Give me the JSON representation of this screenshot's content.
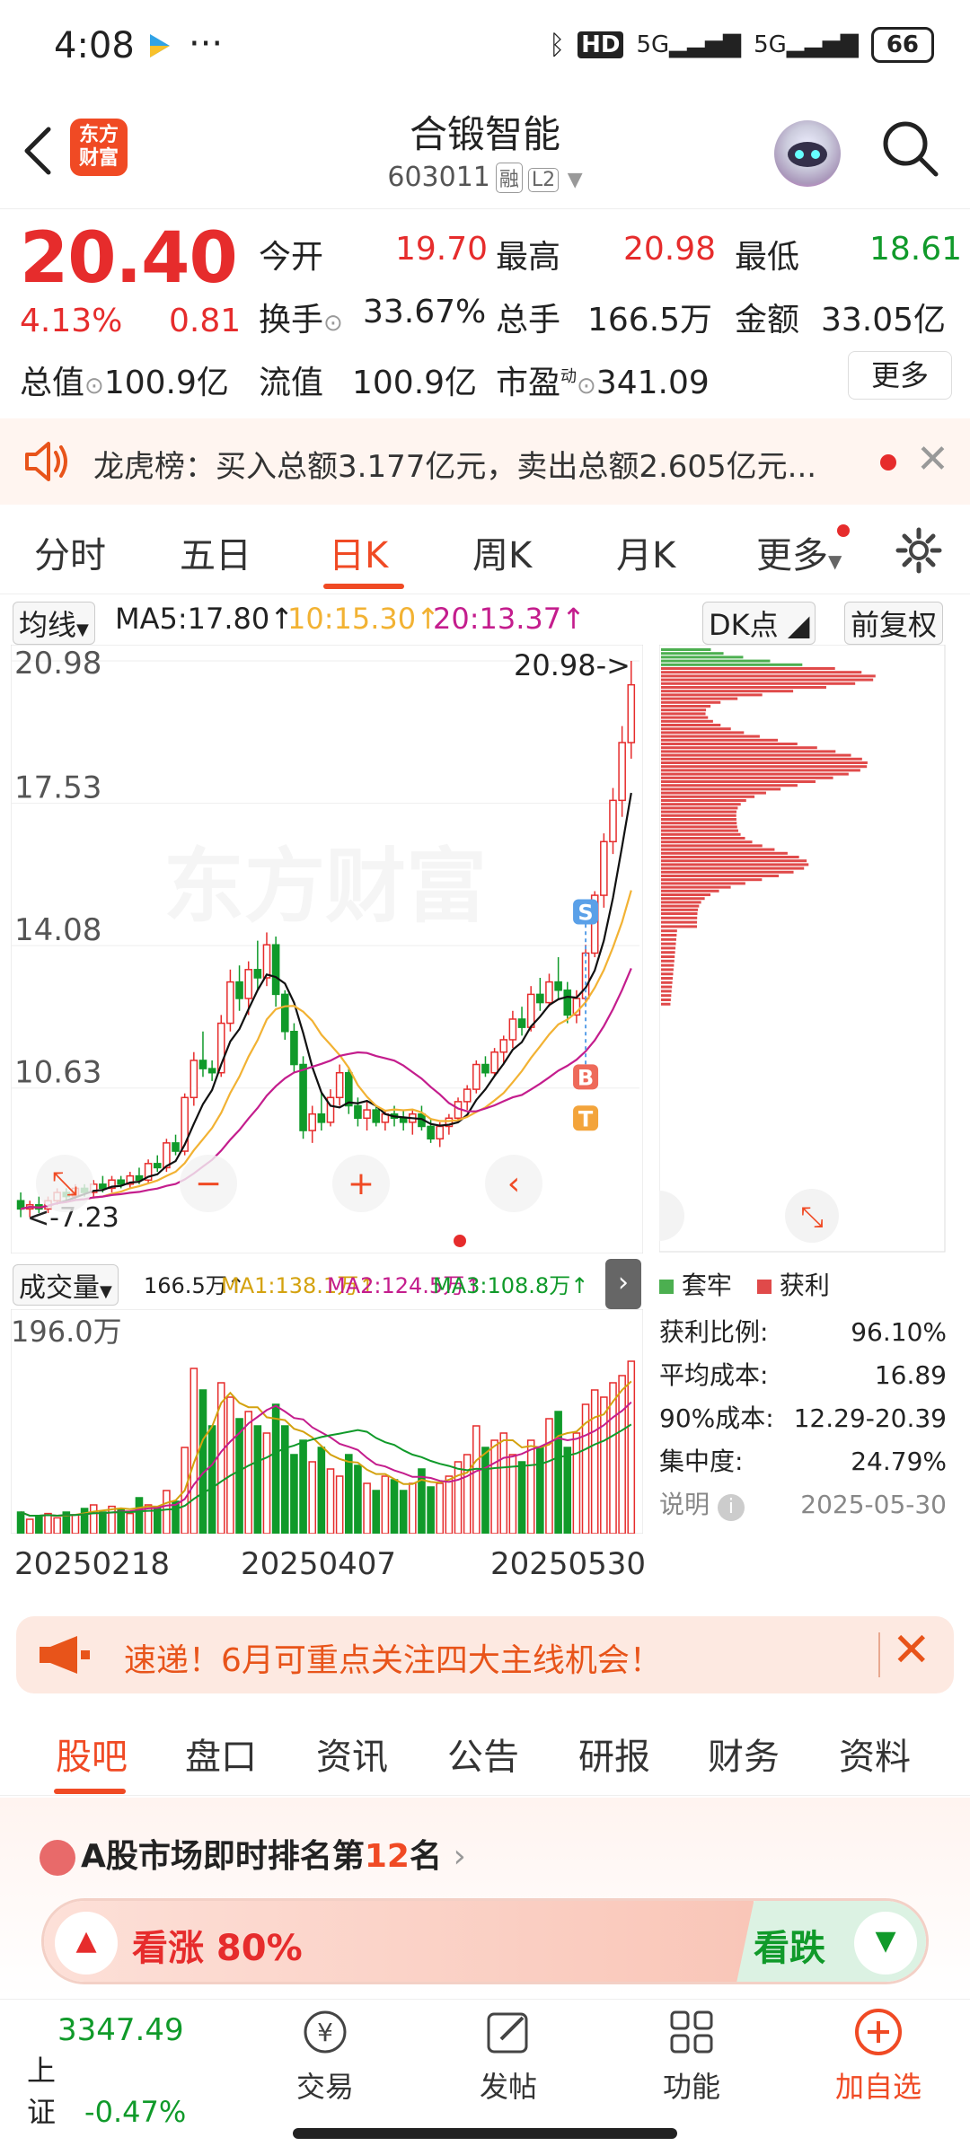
{
  "status_bar": {
    "time": "4:08",
    "dots": "···",
    "battery": "66",
    "network": "5G"
  },
  "header": {
    "logo_text_1": "东方",
    "logo_text_2": "财富",
    "title": "合锻智能",
    "code": "603011",
    "tag_margin": "融",
    "tag_level": "L2"
  },
  "quote": {
    "price": "20.40",
    "change_pct": "4.13%",
    "change": "0.81",
    "open_label": "今开",
    "open": "19.70",
    "high_label": "最高",
    "high": "20.98",
    "low_label": "最低",
    "low": "18.61",
    "turnover_label": "换手",
    "turnover": "33.67%",
    "volume_label": "总手",
    "volume": "166.5万",
    "amount_label": "金额",
    "amount": "33.05亿",
    "mktcap_label": "总值",
    "mktcap": "100.9亿",
    "float_label": "流值",
    "float": "100.9亿",
    "pe_label": "市盈",
    "pe_sup": "动",
    "pe": "341.09",
    "more": "更多"
  },
  "dragon_banner": {
    "text": "龙虎榜：买入总额3.177亿元，卖出总额2.605亿元..."
  },
  "period_tabs": [
    "分时",
    "五日",
    "日K",
    "周K",
    "月K",
    "更多"
  ],
  "chart_bar": {
    "indicator": "均线",
    "ma5_label": "MA5:17.80",
    "ma10_label": "10:15.30",
    "ma20_label": "20:13.37",
    "dk": "DK点",
    "adjust": "前复权"
  },
  "kline": {
    "y_labels": [
      "20.98",
      "17.53",
      "14.08",
      "10.63"
    ],
    "max_note": "20.98->",
    "min_note": "7.23",
    "watermark": "东方财富",
    "sig_s": "S",
    "sig_b": "B",
    "sig_t": "T"
  },
  "volume_bar": {
    "label": "成交量",
    "vol": "166.5万",
    "ma1": "MA1:138.1万",
    "ma2": "MA2:124.5万",
    "ma3": "MA3:108.8万",
    "y_label": "196.0万"
  },
  "dates": [
    "20250218",
    "20250407",
    "20250530"
  ],
  "chip_legend": {
    "trap": "套牢",
    "profit": "获利"
  },
  "chip_stats": [
    {
      "label": "获利比例:",
      "value": "96.10%"
    },
    {
      "label": "平均成本:",
      "value": "16.89"
    },
    {
      "label": "90%成本:",
      "value": "12.29-20.39"
    },
    {
      "label": "集中度:",
      "value": "24.79%"
    }
  ],
  "chip_note": {
    "label": "说明",
    "date": "2025-05-30"
  },
  "notice": {
    "text": "速递！6月可重点关注四大主线机会！"
  },
  "content_tabs": [
    "股吧",
    "盘口",
    "资讯",
    "公告",
    "研报",
    "财务",
    "资料"
  ],
  "rank": {
    "prefix": "A股市场即时排名第",
    "num": "12",
    "suffix": "名"
  },
  "vote": {
    "up": "看涨 80%",
    "down": "看跌"
  },
  "bottom_nav": {
    "index_value": "3347.49",
    "index_name": "上证",
    "index_change": "-0.47%",
    "trade": "交易",
    "post": "发帖",
    "func": "功能",
    "add": "加自选"
  },
  "colors": {
    "up": "#e62c2c",
    "down": "#109a2a",
    "accent": "#f04a24",
    "ma5": "#111111",
    "ma10": "#f2b233",
    "ma20": "#c41d8d"
  },
  "chart_data": {
    "type": "candlestick",
    "price_ticks": [
      20.98,
      17.53,
      14.08,
      10.63
    ],
    "ylim": [
      7.23,
      20.98
    ],
    "candles": [
      [
        7.9,
        8.1,
        7.5,
        7.7
      ],
      [
        7.7,
        7.9,
        7.5,
        7.8
      ],
      [
        7.8,
        8.0,
        7.6,
        7.7
      ],
      [
        7.7,
        8.0,
        7.6,
        7.9
      ],
      [
        7.9,
        8.2,
        7.8,
        8.1
      ],
      [
        8.1,
        8.2,
        7.9,
        8.0
      ],
      [
        8.0,
        8.3,
        7.9,
        8.2
      ],
      [
        8.2,
        8.3,
        8.0,
        8.1
      ],
      [
        8.1,
        8.4,
        8.0,
        8.3
      ],
      [
        8.3,
        8.5,
        8.1,
        8.2
      ],
      [
        8.2,
        8.5,
        8.1,
        8.4
      ],
      [
        8.4,
        8.5,
        8.2,
        8.3
      ],
      [
        8.3,
        8.6,
        8.2,
        8.5
      ],
      [
        8.5,
        8.7,
        8.3,
        8.4
      ],
      [
        8.4,
        8.9,
        8.3,
        8.8
      ],
      [
        8.8,
        9.0,
        8.6,
        8.7
      ],
      [
        8.7,
        9.4,
        8.6,
        9.3
      ],
      [
        9.3,
        9.5,
        9.0,
        9.1
      ],
      [
        9.1,
        10.5,
        9.0,
        10.4
      ],
      [
        10.4,
        11.5,
        10.2,
        11.3
      ],
      [
        11.3,
        12.0,
        10.9,
        11.1
      ],
      [
        11.1,
        11.3,
        10.8,
        11.0
      ],
      [
        11.0,
        12.4,
        10.9,
        12.2
      ],
      [
        12.2,
        13.5,
        12.0,
        13.2
      ],
      [
        13.2,
        13.6,
        12.5,
        12.8
      ],
      [
        12.8,
        13.7,
        12.4,
        13.5
      ],
      [
        13.5,
        14.2,
        13.0,
        13.3
      ],
      [
        13.3,
        14.4,
        13.1,
        14.1
      ],
      [
        14.1,
        14.3,
        12.6,
        12.9
      ],
      [
        12.9,
        13.0,
        11.8,
        12.0
      ],
      [
        12.0,
        12.2,
        11.0,
        11.2
      ],
      [
        11.2,
        11.4,
        9.4,
        9.6
      ],
      [
        9.6,
        10.2,
        9.3,
        10.0
      ],
      [
        10.0,
        10.5,
        9.6,
        9.8
      ],
      [
        9.8,
        10.6,
        9.7,
        10.4
      ],
      [
        10.4,
        11.2,
        10.2,
        11.0
      ],
      [
        11.0,
        11.1,
        10.0,
        10.2
      ],
      [
        10.2,
        10.4,
        9.7,
        9.9
      ],
      [
        9.9,
        10.3,
        9.6,
        10.1
      ],
      [
        10.1,
        10.2,
        9.7,
        9.8
      ],
      [
        9.8,
        10.1,
        9.6,
        10.0
      ],
      [
        10.0,
        10.2,
        9.7,
        9.9
      ],
      [
        9.9,
        10.1,
        9.6,
        9.8
      ],
      [
        9.8,
        10.1,
        9.5,
        10.0
      ],
      [
        10.0,
        10.2,
        9.6,
        9.7
      ],
      [
        9.7,
        9.9,
        9.3,
        9.4
      ],
      [
        9.4,
        9.8,
        9.2,
        9.7
      ],
      [
        9.7,
        10.0,
        9.5,
        9.9
      ],
      [
        9.9,
        10.4,
        9.8,
        10.3
      ],
      [
        10.3,
        10.7,
        10.1,
        10.6
      ],
      [
        10.6,
        11.3,
        10.5,
        11.2
      ],
      [
        11.2,
        11.4,
        10.9,
        11.0
      ],
      [
        11.0,
        11.6,
        10.9,
        11.5
      ],
      [
        11.5,
        11.9,
        11.2,
        11.8
      ],
      [
        11.8,
        12.5,
        11.6,
        12.3
      ],
      [
        12.3,
        12.6,
        11.9,
        12.1
      ],
      [
        12.1,
        13.1,
        12.0,
        12.9
      ],
      [
        12.9,
        13.3,
        12.5,
        12.7
      ],
      [
        12.7,
        13.4,
        12.6,
        13.2
      ],
      [
        13.2,
        13.8,
        12.8,
        13.0
      ],
      [
        13.0,
        13.2,
        12.2,
        12.4
      ],
      [
        12.4,
        13.0,
        12.2,
        12.8
      ],
      [
        12.8,
        14.1,
        12.7,
        13.9
      ],
      [
        13.9,
        15.4,
        13.8,
        15.3
      ],
      [
        15.3,
        16.8,
        15.0,
        16.6
      ],
      [
        16.6,
        17.9,
        16.3,
        17.6
      ],
      [
        17.6,
        19.4,
        17.2,
        19.0
      ],
      [
        19.0,
        20.98,
        18.61,
        20.4
      ]
    ]
  }
}
